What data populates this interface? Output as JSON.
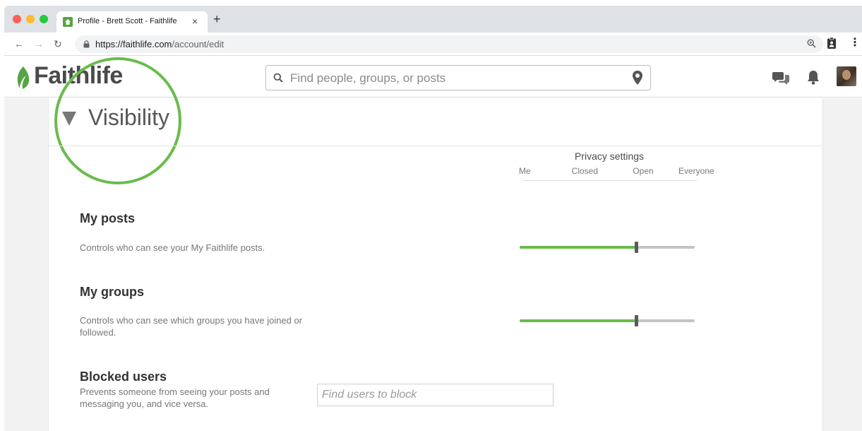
{
  "browser": {
    "tab_title": "Profile - Brett Scott - Faithlife",
    "tab_close": "×",
    "new_tab": "+",
    "url_host": "https://faithlife.com",
    "url_path": "/account/edit"
  },
  "header": {
    "logo": "Faithlife",
    "search_placeholder": "Find people, groups, or posts"
  },
  "section": {
    "title": "Visibility"
  },
  "privacy": {
    "title": "Privacy settings",
    "levels": [
      "Me",
      "Closed",
      "Open",
      "Everyone"
    ]
  },
  "rows": [
    {
      "title": "My posts",
      "description": "Controls who can see your My Faithlife posts.",
      "level_index": 2
    },
    {
      "title": "My groups",
      "description": "Controls who can see which groups you have joined or followed.",
      "level_index": 2
    }
  ],
  "blocked": {
    "title": "Blocked users",
    "description": "Prevents someone from seeing your posts and messaging you, and vice versa.",
    "placeholder": "Find users to block"
  },
  "colors": {
    "accent_green": "#6abb4c",
    "track_gray": "#c4c4c4"
  }
}
